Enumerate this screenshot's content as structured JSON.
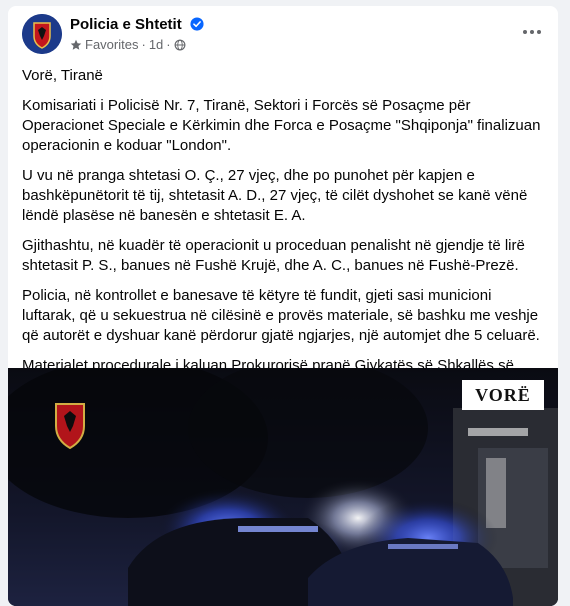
{
  "post": {
    "page_name": "Policia e Shtetit",
    "audience": "Favorites",
    "separator": "·",
    "time": "1d",
    "separator2": "·"
  },
  "icons": {
    "verified": "verified-badge-icon",
    "favorites": "star-icon",
    "privacy": "globe-icon",
    "more": "more-options-icon"
  },
  "content": {
    "location": "Vorë, Tiranë",
    "paragraphs": [
      "Komisariati i Policisë Nr. 7, Tiranë, Sektori i Forcës së Posaçme për Operacionet Speciale e Kërkimin dhe Forca e Posaçme \"Shqiponja\" finalizuan operacionin e koduar \"London\".",
      "U vu në pranga shtetasi O. Ç., 27 vjeç, dhe po punohet për kapjen e bashkëpunëtorit të tij, shtetasit A. D., 27 vjeç, të cilët dyshohet se kanë vënë lëndë plasëse në banesën e shtetasit E. A.",
      "Gjithashtu, në kuadër të operacionit u proceduan penalisht në gjendje të lirë shtetasit P. S., banues në Fushë Krujë, dhe A. C., banues në Fushë-Prezë.",
      "Policia, në kontrollet e banesave të këtyre të fundit, gjeti sasi municioni luftarak, që u sekuestrua në cilësinë e provës materiale, së bashku me veshje që autorët e dyshuar kanë përdorur gjatë ngjarjes, një automjet dhe 5 celuarë.",
      "Materialet procedurale i kaluan Prokurorisë pranë Gjykatës së Shkallës së Parë të Juridiksionit të Përgjithshëm, Tiranë."
    ]
  },
  "media": {
    "overlay_label": "VORË"
  },
  "colors": {
    "verified_blue": "#0866ff",
    "police_blue": "#1c3a8a",
    "police_red": "#c4161c",
    "siren_blue": "#3d5bff"
  }
}
